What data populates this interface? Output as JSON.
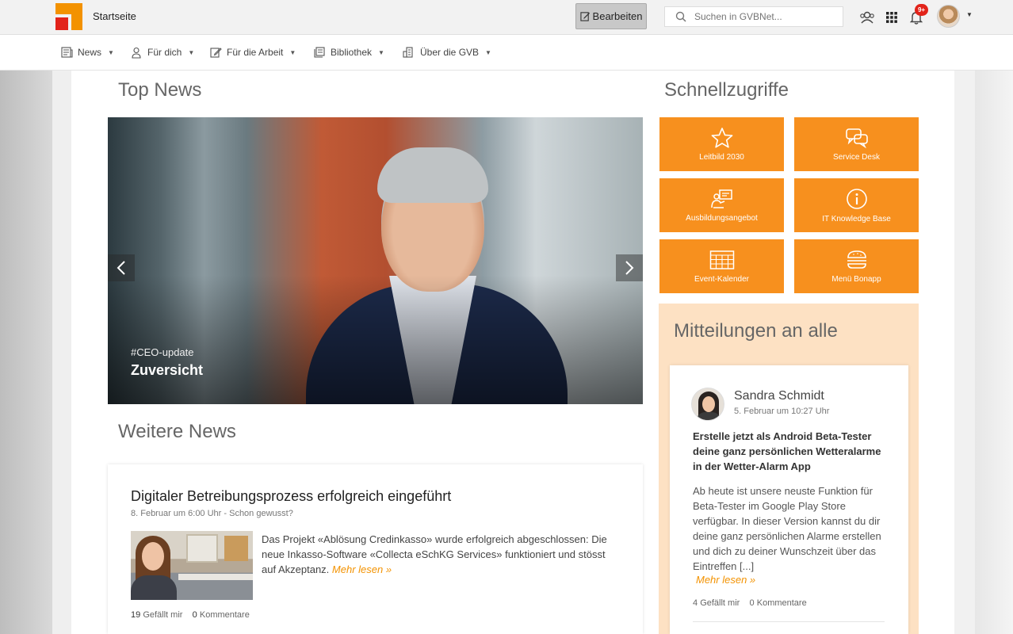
{
  "header": {
    "site_title": "Startseite",
    "edit_label": "Bearbeiten",
    "search_placeholder": "Suchen in GVBNet...",
    "notifications_badge": "9+"
  },
  "nav": {
    "items": [
      {
        "label": "News",
        "icon": "newspaper-icon"
      },
      {
        "label": "Für dich",
        "icon": "person-icon"
      },
      {
        "label": "Für die Arbeit",
        "icon": "edit-icon"
      },
      {
        "label": "Bibliothek",
        "icon": "library-icon"
      },
      {
        "label": "Über die GVB",
        "icon": "building-icon"
      }
    ]
  },
  "top_news": {
    "title": "Top News",
    "slide_tag": "#CEO-update",
    "slide_title": "Zuversicht"
  },
  "more_news": {
    "title": "Weitere News",
    "article": {
      "title": "Digitaler Betreibungsprozess erfolgreich eingeführt",
      "meta": "8. Februar um 6:00 Uhr - Schon gewusst?",
      "text": "Das Projekt «Ablösung Credinkasso» wurde erfolgreich abgeschlossen: Die neue Inkasso-Software «Collecta eSchKG Services» funktioniert und stösst auf Akzeptanz.",
      "more_label": "Mehr lesen »",
      "likes_count": "19",
      "likes_label": "Gefällt mir",
      "comments_count": "0",
      "comments_label": "Kommentare"
    }
  },
  "quick_access": {
    "title": "Schnellzugriffe",
    "tiles": [
      {
        "label": "Leitbild 2030",
        "icon": "star-icon"
      },
      {
        "label": "Service Desk",
        "icon": "chat-icon"
      },
      {
        "label": "Ausbildungsangebot",
        "icon": "presentation-icon"
      },
      {
        "label": "IT Knowledge Base",
        "icon": "info-icon"
      },
      {
        "label": "Event-Kalender",
        "icon": "calendar-icon"
      },
      {
        "label": "Menü Bonapp",
        "icon": "burger-icon"
      }
    ]
  },
  "announcements": {
    "title": "Mitteilungen an alle",
    "post": {
      "author": "Sandra Schmidt",
      "date": "5. Februar um 10:27 Uhr",
      "title": "Erstelle jetzt als Android Beta-Tester deine ganz persönlichen Wetteralarme in der Wetter-Alarm App",
      "text": "Ab heute ist unsere neuste Funktion für Beta-Tester im Google Play Store verfügbar. In dieser Version kannst du dir deine ganz persönlichen Alarme erstellen und dich zu deiner Wunschzeit über das Eintreffen [...]",
      "more_label": "Mehr lesen »",
      "likes_count": "4",
      "likes_label": "Gefällt mir",
      "comments_count": "0",
      "comments_label": "Kommentare"
    }
  },
  "colors": {
    "accent": "#f7901e",
    "logo_red": "#e2231a",
    "panel": "#fde1c3"
  }
}
